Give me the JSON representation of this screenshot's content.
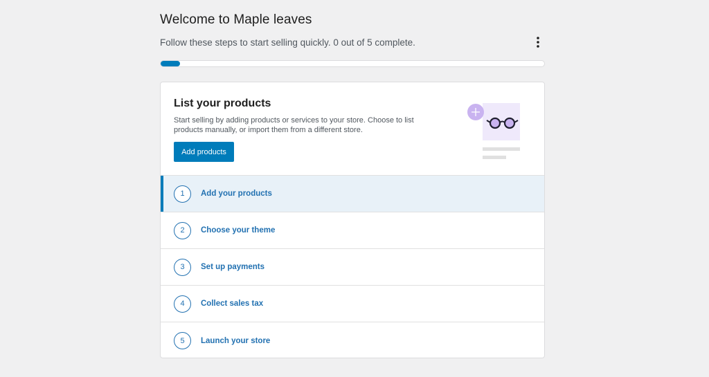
{
  "header": {
    "title": "Welcome to Maple leaves",
    "subtitle": "Follow these steps to start selling quickly. 0 out of 5 complete.",
    "menu_icon": "vertical-ellipsis-icon"
  },
  "progress": {
    "completed": 0,
    "total": 5,
    "fill_fraction": 0.05,
    "color": "#007cba"
  },
  "current_task": {
    "title": "List your products",
    "description": "Start selling by adding products or services to your store. Choose to list products manually, or import them from a different store.",
    "button_label": "Add products",
    "illustration": "glasses-product-illustration"
  },
  "steps": [
    {
      "number": "1",
      "label": "Add your products",
      "active": true
    },
    {
      "number": "2",
      "label": "Choose your theme",
      "active": false
    },
    {
      "number": "3",
      "label": "Set up payments",
      "active": false
    },
    {
      "number": "4",
      "label": "Collect sales tax",
      "active": false
    },
    {
      "number": "5",
      "label": "Launch your store",
      "active": false
    }
  ],
  "colors": {
    "accent": "#007cba",
    "link": "#2271b1",
    "active_row_bg": "#e8f1f8",
    "page_bg": "#f0f0f1"
  }
}
